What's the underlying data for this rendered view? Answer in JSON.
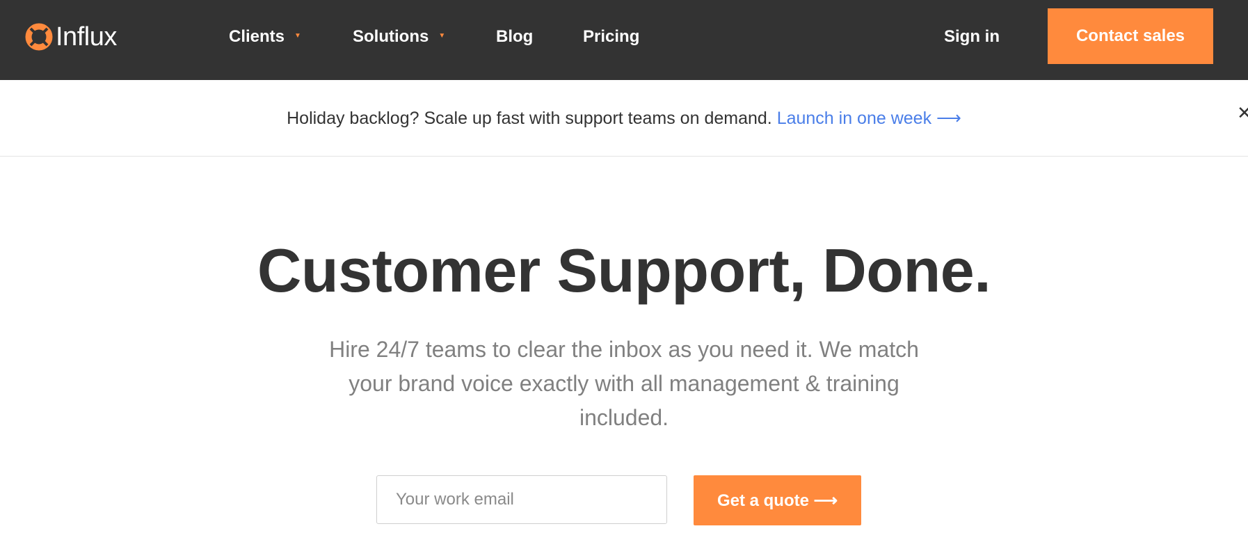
{
  "brand": {
    "name": "Influx",
    "accent_color": "#ff8a3d",
    "nav_bg": "#333333",
    "link_color": "#4a7ee8"
  },
  "nav": {
    "items": [
      {
        "label": "Clients",
        "has_dropdown": true
      },
      {
        "label": "Solutions",
        "has_dropdown": true
      },
      {
        "label": "Blog",
        "has_dropdown": false
      },
      {
        "label": "Pricing",
        "has_dropdown": false
      }
    ],
    "sign_in": "Sign in",
    "contact_sales": "Contact sales"
  },
  "banner": {
    "text": "Holiday backlog? Scale up fast with support teams on demand.",
    "link": "Launch in one week ⟶",
    "close_icon": "close-icon"
  },
  "hero": {
    "title": "Customer Support, Done.",
    "subtitle": "Hire 24/7 teams to clear the inbox as you need it. We match your brand voice exactly with all management & training included.",
    "email_placeholder": "Your work email",
    "cta": "Get a quote ⟶"
  }
}
